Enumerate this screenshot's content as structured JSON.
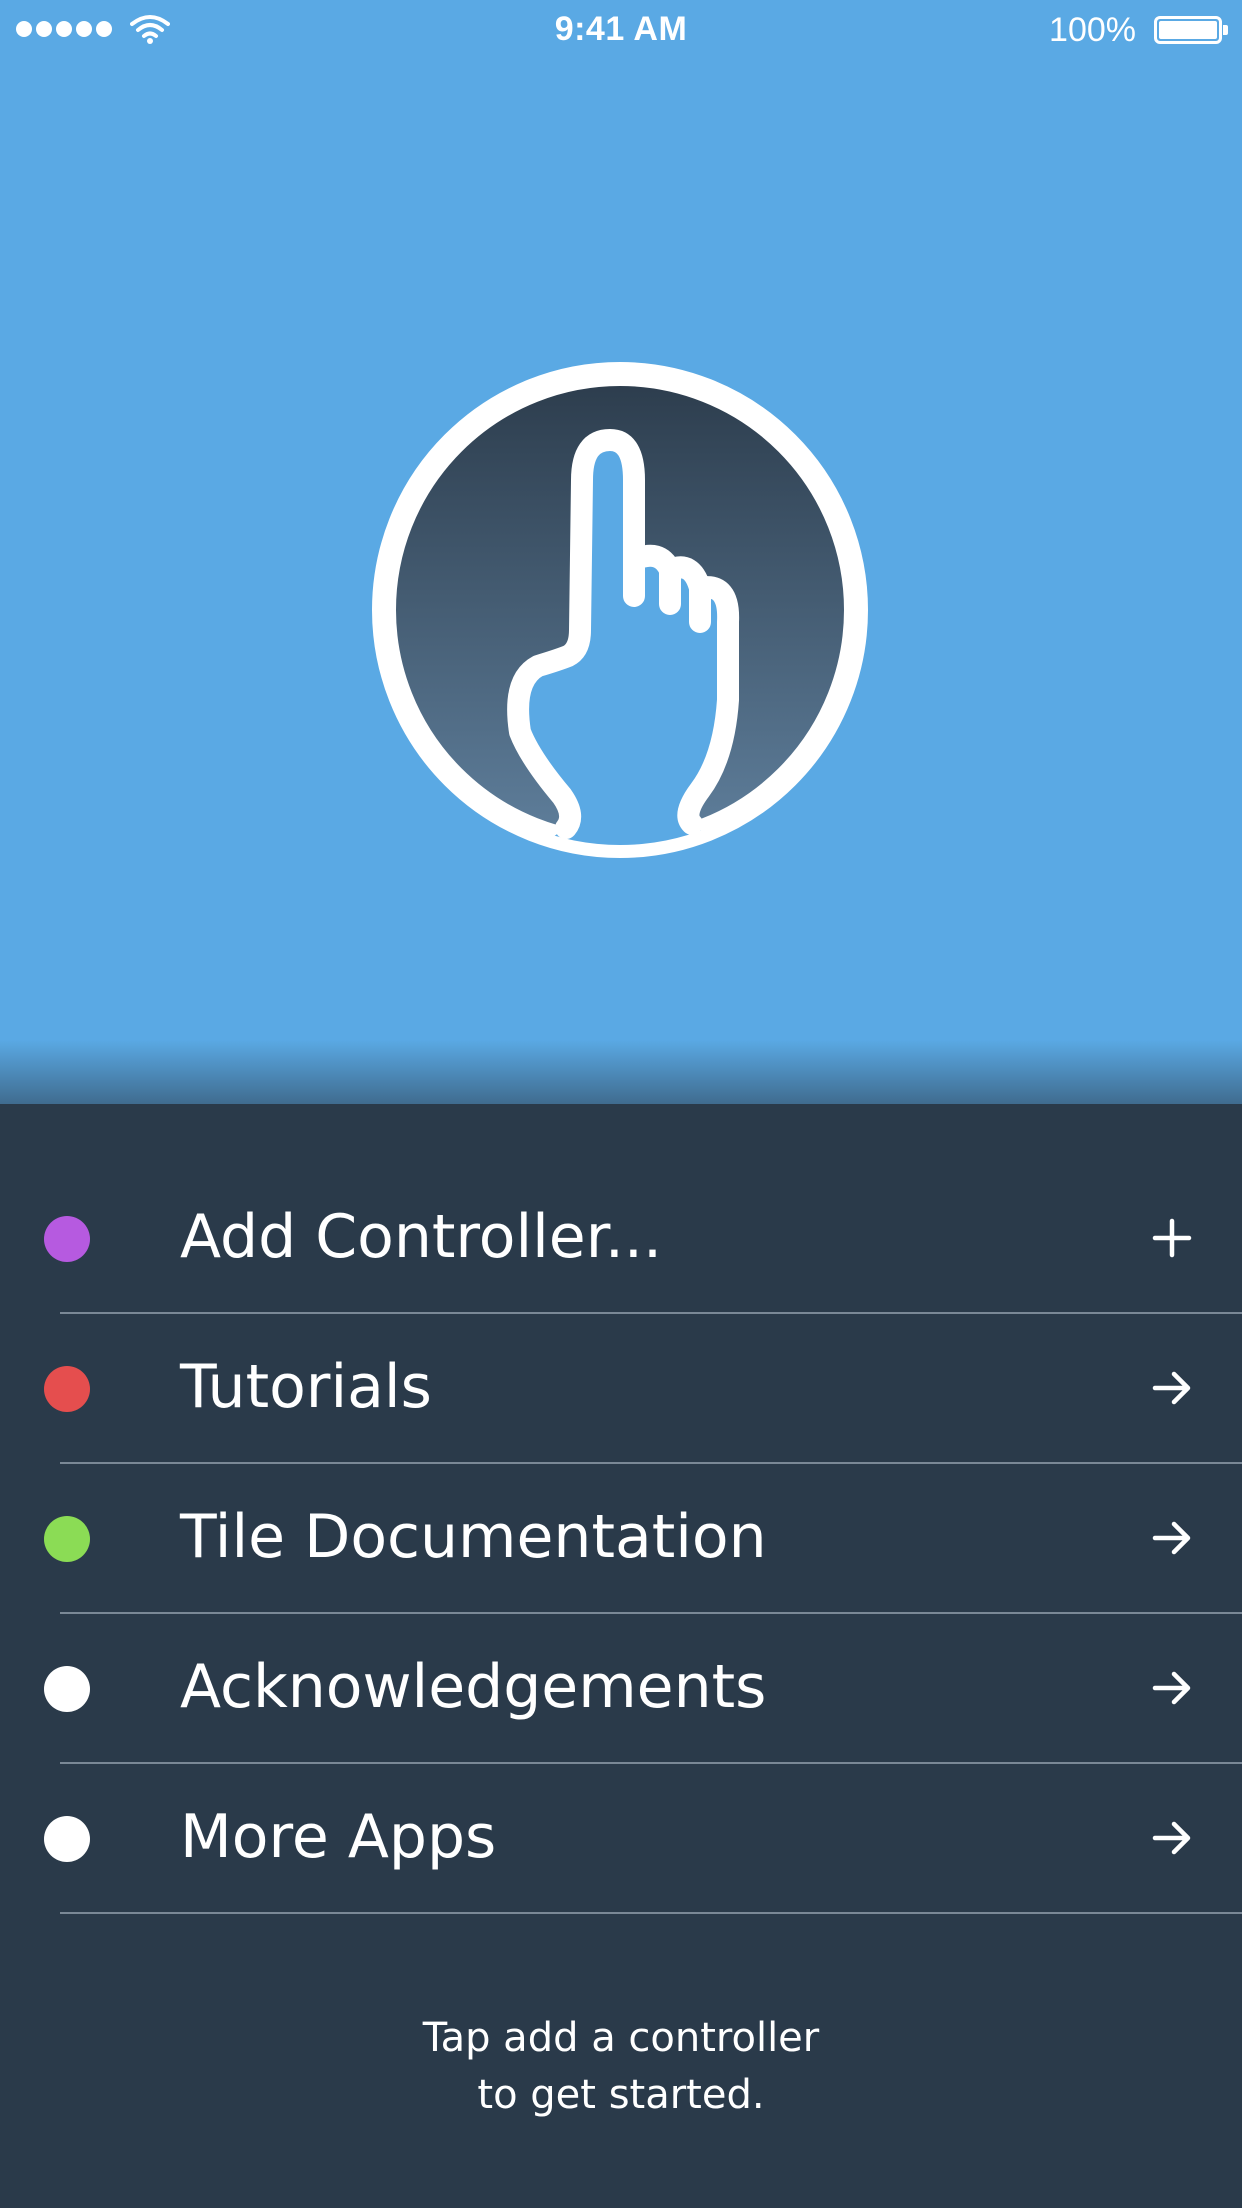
{
  "status_bar": {
    "time": "9:41 AM",
    "battery_percent": "100%",
    "signal_icon": "signal-dots-icon",
    "wifi_icon": "wifi-icon",
    "battery_icon": "battery-icon"
  },
  "hero": {
    "background_color": "#5aa9e4",
    "logo_icon": "pointing-hand-icon"
  },
  "menu": {
    "items": [
      {
        "label": "Add Controller...",
        "dot_color": "#b65ae0",
        "action_icon": "plus-icon"
      },
      {
        "label": "Tutorials",
        "dot_color": "#e54e4e",
        "action_icon": "arrow-right-icon"
      },
      {
        "label": "Tile Documentation",
        "dot_color": "#8bdc55",
        "action_icon": "arrow-right-icon"
      },
      {
        "label": "Acknowledgements",
        "dot_color": "#ffffff",
        "action_icon": "arrow-right-icon"
      },
      {
        "label": "More Apps",
        "dot_color": "#ffffff",
        "action_icon": "arrow-right-icon"
      }
    ]
  },
  "footer": {
    "line1": "Tap add a controller",
    "line2": "to get started."
  },
  "colors": {
    "panel_background": "#2a3a4a",
    "divider": "#7a8896",
    "text": "#ffffff"
  }
}
